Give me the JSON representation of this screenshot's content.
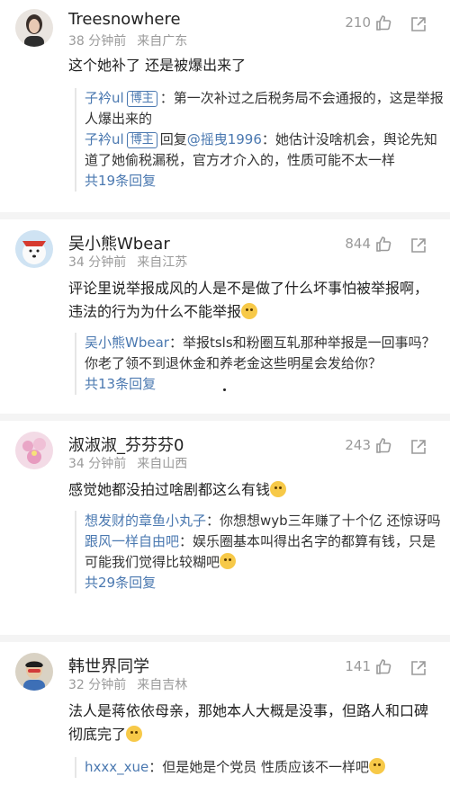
{
  "comments": [
    {
      "user": "Treesnowhere",
      "time": "38 分钟前",
      "location": "来自广东",
      "likes": "210",
      "text": "这个她补了 还是被爆出来了",
      "replies": [
        {
          "name": "子衿ul",
          "tag": "博主",
          "sep": "：",
          "text": "第一次补过之后税务局不会通报的，这是举报人爆出来的"
        },
        {
          "name": "子衿ul",
          "tag": "博主",
          "prefix": "回复",
          "mention": "@摇曳1996",
          "sep": "：",
          "text": "她估计没啥机会，舆论先知道了她偷税漏税，官方才介入的，性质可能不太一样"
        }
      ],
      "more": "共19条回复"
    },
    {
      "user": "吴小熊Wbear",
      "time": "34 分钟前",
      "location": "来自江苏",
      "likes": "844",
      "text": "评论里说举报成风的人是不是做了什么坏事怕被举报啊，违法的行为为什么不能举报",
      "replies": [
        {
          "name": "吴小熊Wbear",
          "sep": "：",
          "text": "举报tsls和粉圈互轧那种举报是一回事吗？你老了领不到退休金和养老金这些明星会发给你？"
        }
      ],
      "more": "共13条回复"
    },
    {
      "user": "淑淑淑_芬芬芬0",
      "time": "34 分钟前",
      "location": "来自山西",
      "likes": "243",
      "text": "感觉她都没拍过啥剧都这么有钱",
      "replies": [
        {
          "name": "想发财的章鱼小丸子",
          "sep": "：",
          "text": "你想想wyb三年赚了十个亿 还惊讶吗"
        },
        {
          "name": "跟风一样自由吧",
          "sep": "：",
          "text": "娱乐圈基本叫得出名字的都算有钱，只是可能我们觉得比较糊吧"
        }
      ],
      "more": "共29条回复"
    },
    {
      "user": "韩世界同学",
      "time": "32 分钟前",
      "location": "来自吉林",
      "likes": "141",
      "text": "法人是蒋依依母亲，那她本人大概是没事，但路人和口碑彻底完了",
      "replies": [
        {
          "name": "hxxx_xue",
          "sep": "：",
          "text": "但是她是个党员 性质应该不一样吧"
        }
      ]
    }
  ],
  "colors": {
    "link": "#4a78b0",
    "meta": "#9a9a9a"
  }
}
